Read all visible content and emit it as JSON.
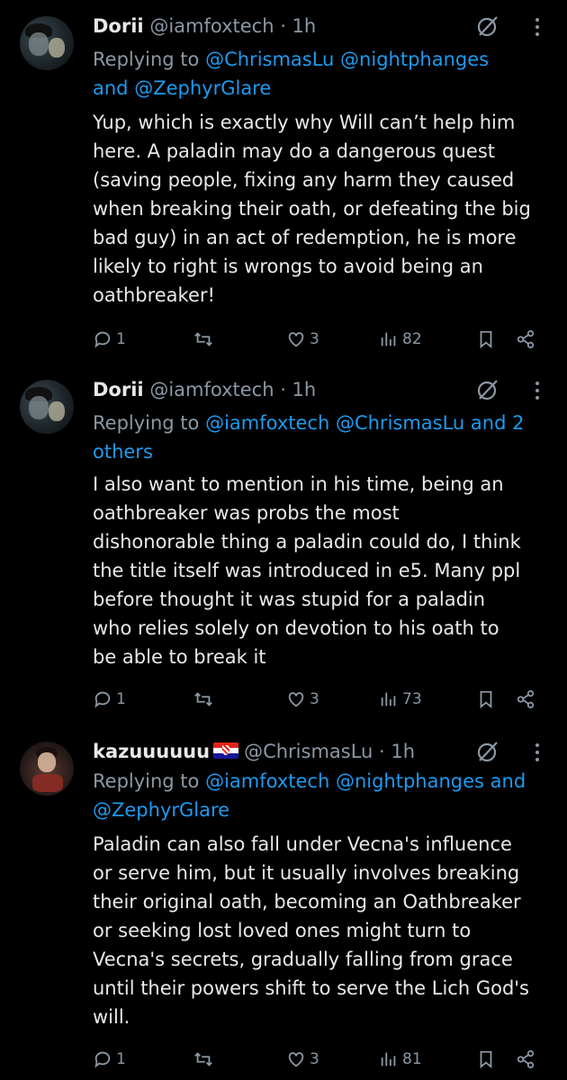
{
  "tweets": [
    {
      "name": "Dorii",
      "flag": "",
      "handle": "@iamfoxtech",
      "time": "· 1h",
      "replying_prefix": "Replying to",
      "replying_mentions": [
        " @ChrismasLu",
        " @nightphanges"
      ],
      "replying_line2_plain": "and",
      "replying_line2_mentions": [
        " @ZephyrGlare"
      ],
      "body_lines": [
        "Yup, which is exactly why Will can’t help him",
        "here. A paladin may do a dangerous quest",
        "(saving people, fixing any harm they caused",
        "when breaking their oath, or defeating the big",
        "bad guy) in an act of redemption, he is more",
        "likely to right is wrongs to avoid being an",
        "oathbreaker!"
      ],
      "replies": "1",
      "reposts": "",
      "likes": "3",
      "views": "82"
    },
    {
      "name": "Dorii",
      "flag": "",
      "handle": "@iamfoxtech",
      "time": "· 1h",
      "replying_prefix": "Replying to",
      "replying_mentions": [
        " @iamfoxtech",
        " @ChrismasLu and 2"
      ],
      "replying_line2_plain": "",
      "replying_line2_mentions": [
        "others"
      ],
      "body_lines": [
        "I also want to mention in his time, being an",
        "oathbreaker was probs the most",
        "dishonorable thing a paladin could do, I think",
        "the title itself was introduced in e5. Many ppl",
        "before thought it was stupid for a paladin",
        "who relies solely on devotion to his oath to",
        "be able to break it"
      ],
      "replies": "1",
      "reposts": "",
      "likes": "3",
      "views": "73"
    },
    {
      "name": "kazuuuuuu",
      "flag": "croatia-flag",
      "handle": "@ChrismasLu",
      "time": "· 1h",
      "replying_prefix": "Replying to",
      "replying_mentions": [
        " @iamfoxtech",
        " @nightphanges and"
      ],
      "replying_line2_plain": "",
      "replying_line2_mentions": [
        "@ZephyrGlare"
      ],
      "body_lines": [
        "Paladin can also fall under Vecna's influence",
        "or serve him, but it usually involves breaking",
        "their original oath, becoming an Oathbreaker",
        "or seeking lost loved ones might turn to",
        "Vecna's secrets, gradually falling from grace",
        "until their powers shift to serve the Lich God's",
        "will."
      ],
      "replies": "1",
      "reposts": "",
      "likes": "3",
      "views": "81"
    }
  ],
  "colors": {
    "background": "#000000",
    "text": "#e7e9ea",
    "muted": "#8b98a5",
    "link": "#1d9bf0"
  },
  "icons": [
    "grok-icon",
    "more-icon",
    "reply-icon",
    "repost-icon",
    "like-icon",
    "views-icon",
    "bookmark-icon",
    "share-icon"
  ]
}
